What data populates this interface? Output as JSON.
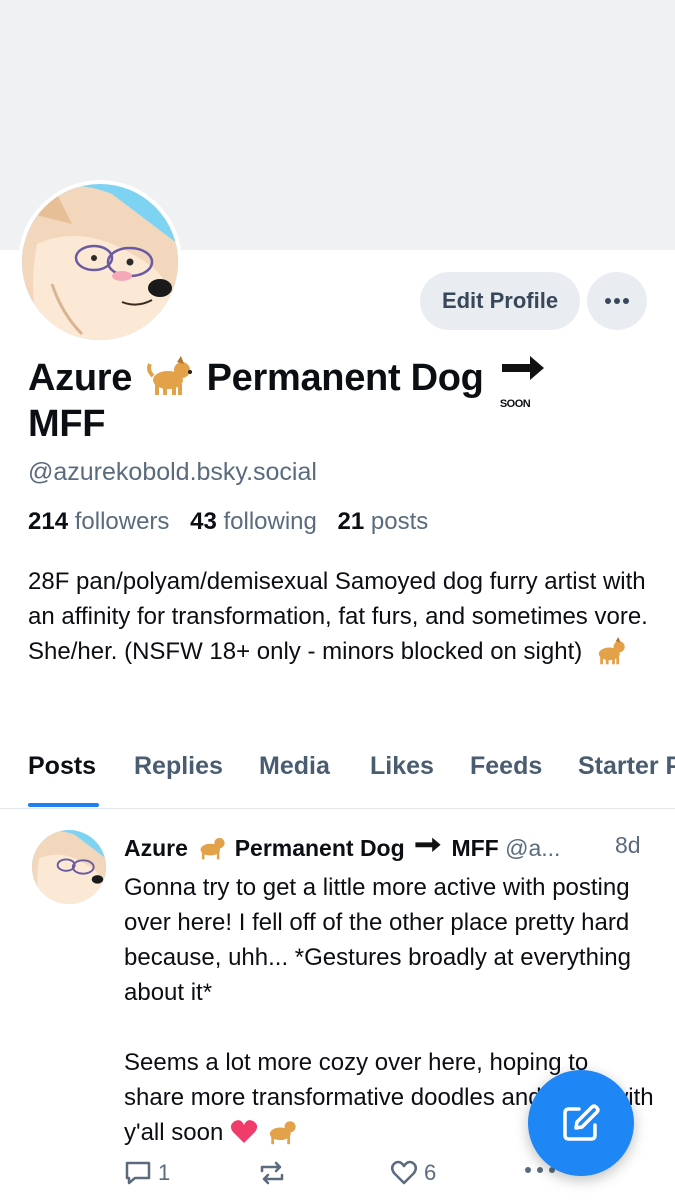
{
  "profile": {
    "name_part1": "Azure",
    "name_part2": "Permanent Dog",
    "name_part3": "MFF",
    "handle": "@azurekobold.bsky.social",
    "followers_count": "214",
    "followers_label": "followers",
    "following_count": "43",
    "following_label": "following",
    "posts_count": "21",
    "posts_label": "posts",
    "bio": "28F pan/polyam/demisexual Samoyed dog furry artist with an affinity for transformation, fat furs, and sometimes vore. She/her. (NSFW 18+ only - minors blocked on sight)",
    "edit_button": "Edit Profile",
    "soon_badge": "SOON"
  },
  "tabs": [
    "Posts",
    "Replies",
    "Media",
    "Likes",
    "Feeds",
    "Starter P"
  ],
  "post": {
    "author_part1": "Azure",
    "author_part2": "Permanent Dog",
    "author_part3": "MFF",
    "handle_trunc": "@a...",
    "time": "8d",
    "paragraph1": "Gonna try to get a little more active with posting over here! I fell off of the other place pretty hard because, uhh... *Gestures broadly at everything about it*",
    "paragraph2": "Seems a lot more cozy over here, hoping to share more transformative doodles and vibes with y'all soon",
    "reply_count": "1",
    "like_count": "6"
  },
  "icons": {
    "more": "more-horizontal-icon",
    "compose": "compose-icon",
    "reply": "reply-icon",
    "repost": "repost-icon",
    "like": "heart-icon",
    "soon": "soon-arrow-emoji",
    "dog": "dog-emoji",
    "heart": "red-heart-emoji"
  },
  "colors": {
    "accent": "#1f86f5",
    "banner": "#eff1f3",
    "muted_text": "#5a6b7e"
  }
}
